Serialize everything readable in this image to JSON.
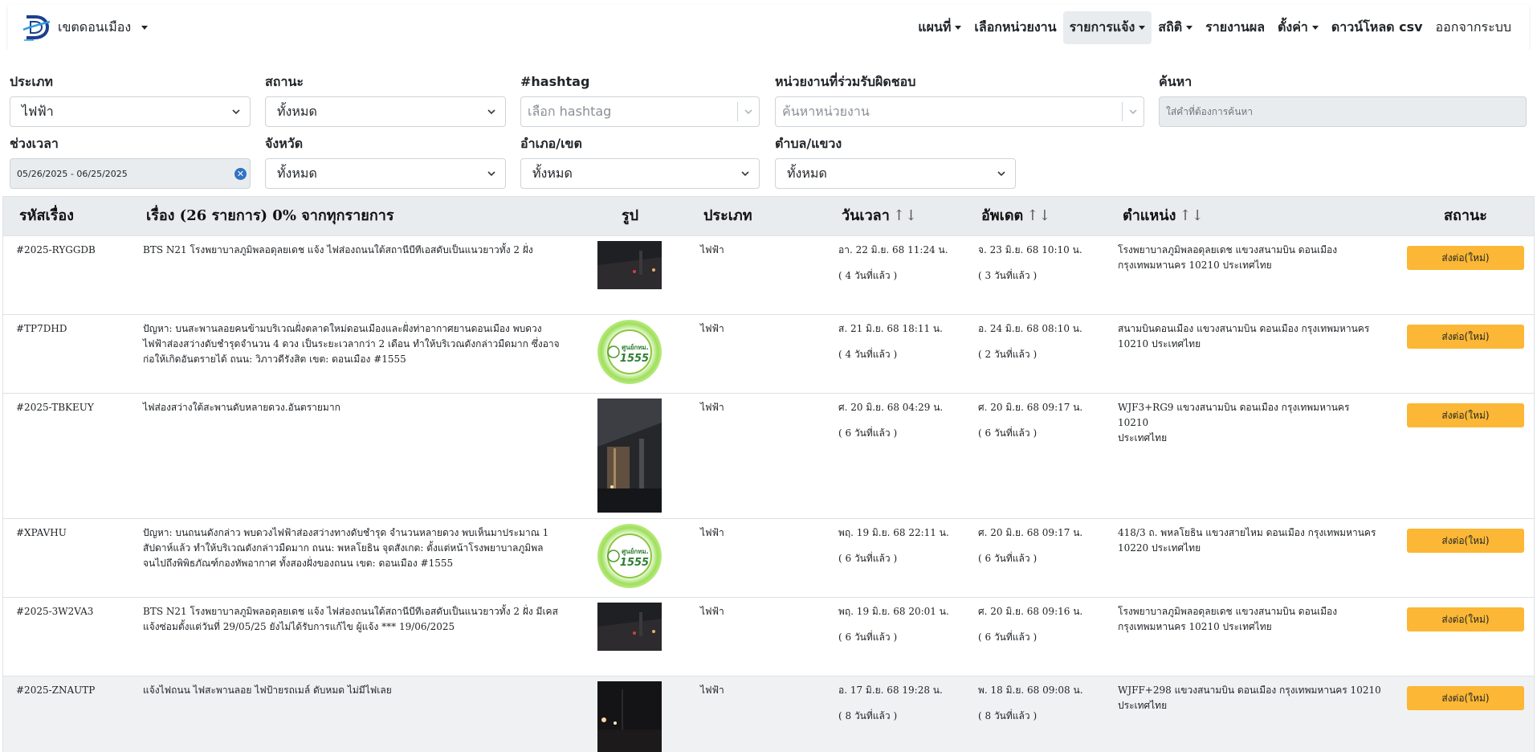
{
  "nav": {
    "district": "เขตดอนเมือง",
    "items": [
      {
        "label": "แผนที่",
        "dropdown": true,
        "active": false,
        "bold": true
      },
      {
        "label": "เลือกหน่วยงาน",
        "dropdown": false,
        "active": false,
        "bold": true
      },
      {
        "label": "รายการแจ้ง",
        "dropdown": true,
        "active": true,
        "bold": true
      },
      {
        "label": "สถิติ",
        "dropdown": true,
        "active": false,
        "bold": true
      },
      {
        "label": "รายงานผล",
        "dropdown": false,
        "active": false,
        "bold": true
      },
      {
        "label": "ตั้งค่า",
        "dropdown": true,
        "active": false,
        "bold": true
      },
      {
        "label": "ดาวน์โหลด csv",
        "dropdown": false,
        "active": false,
        "bold": true
      },
      {
        "label": "ออกจากระบบ",
        "dropdown": false,
        "active": false,
        "bold": false
      }
    ]
  },
  "filters": {
    "type": {
      "label": "ประเภท",
      "value": "ไฟฟ้า"
    },
    "status": {
      "label": "สถานะ",
      "value": "ทั้งหมด"
    },
    "hashtag": {
      "label": "#hashtag",
      "placeholder": "เลือก hashtag"
    },
    "agency": {
      "label": "หน่วยงานที่ร่วมรับผิดชอบ",
      "placeholder": "ค้นหาหน่วยงาน"
    },
    "search": {
      "label": "ค้นหา",
      "placeholder": "ใส่คำที่ต้องการค้นหา"
    },
    "period": {
      "label": "ช่วงเวลา",
      "value": "05/26/2025 - 06/25/2025"
    },
    "province": {
      "label": "จังหวัด",
      "value": "ทั้งหมด"
    },
    "district": {
      "label": "อำเภอ/เขต",
      "value": "ทั้งหมด"
    },
    "subdistrict": {
      "label": "ตำบล/แขวง",
      "value": "ทั้งหมด"
    }
  },
  "table": {
    "headers": {
      "id": "รหัสเรื่อง",
      "title": "เรื่อง (26 รายการ) 0% จากทุกรายการ",
      "image": "รูป",
      "type": "ประเภท",
      "datetime": "วันเวลา",
      "updated": "อัพเดต",
      "location": "ตำแหน่ง",
      "status": "สถานะ"
    },
    "sort_icon": "↑↓",
    "rows": [
      {
        "id": "#2025-RYGGDB",
        "title": [
          "BTS N21 โรงพยาบาลภูมิพลอดุลยเดช แจ้ง ไฟส่องถนนใต้สถานีบีทีเอสดับเป็นแนวยาวทั้ง 2 ฝั่ง"
        ],
        "image": "night-road-photo",
        "type": "ไฟฟ้า",
        "datetime": "อา. 22 มิ.ย. 68 11:24 น.",
        "datetime_ago": "( 4 วันที่แล้ว )",
        "updated": "จ. 23 มิ.ย. 68 10:10 น.",
        "updated_ago": "( 3 วันที่แล้ว )",
        "location": [
          "โรงพยาบาลภูมิพลอดุลยเดช แขวงสนามบิน ดอนเมือง",
          "กรุงเทพมหานคร 10210 ประเทศไทย"
        ],
        "status": "ส่งต่อ(ใหม่)"
      },
      {
        "id": "#TP7DHD",
        "title": [
          "ปัญหา: บนสะพานลอยคนข้ามบริเวณฝั่งตลาดใหม่ดอนเมืองและฝั่งท่าอากาศยานดอนเมือง พบดวง",
          "ไฟฟ้าส่องสว่างดับชำรุดจำนวน 4 ดวง เป็นระยะเวลากว่า 2 เดือน ทำให้บริเวณดังกล่าวมืดมาก ซึ่งอาจ",
          "ก่อให้เกิดอันตรายได้ ถนน: วิภาวดีรังสิต เขต: ดอนเมือง #1555"
        ],
        "image": "1555-logo",
        "type": "ไฟฟ้า",
        "datetime": "ส. 21 มิ.ย. 68 18:11 น.",
        "datetime_ago": "( 4 วันที่แล้ว )",
        "updated": "อ. 24 มิ.ย. 68 08:10 น.",
        "updated_ago": "( 2 วันที่แล้ว )",
        "location": [
          "สนามบินดอนเมือง แขวงสนามบิน ดอนเมือง กรุงเทพมหานคร",
          "10210 ประเทศไทย"
        ],
        "status": "ส่งต่อ(ใหม่)"
      },
      {
        "id": "#2025-TBKEUY",
        "title": [
          "ไฟส่องสว่างใต้สะพานดับหลายดวง.อันตรายมาก"
        ],
        "image": "under-bridge-photo",
        "type": "ไฟฟ้า",
        "datetime": "ศ. 20 มิ.ย. 68 04:29 น.",
        "datetime_ago": "( 6 วันที่แล้ว )",
        "updated": "ศ. 20 มิ.ย. 68 09:17 น.",
        "updated_ago": "( 6 วันที่แล้ว )",
        "location": [
          "WJF3+RG9 แขวงสนามบิน ดอนเมือง กรุงเทพมหานคร 10210",
          "ประเทศไทย"
        ],
        "status": "ส่งต่อ(ใหม่)"
      },
      {
        "id": "#XPAVHU",
        "title": [
          "ปัญหา: บนถนนดังกล่าว พบดวงไฟฟ้าส่องสว่างทางดับชำรุด จำนวนหลายดวง พบเห็นมาประมาณ 1",
          "สัปดาห์แล้ว ทำให้บริเวณดังกล่าวมืดมาก ถนน: พหลโยธิน จุดสังเกต: ตั้งแต่หน้าโรงพยาบาลภูมิพล",
          "จนไปถึงพิพิธภัณฑ์กองทัพอากาศ ทั้งสองฝั่งของถนน เขต: ดอนเมือง #1555"
        ],
        "image": "1555-logo",
        "type": "ไฟฟ้า",
        "datetime": "พฤ. 19 มิ.ย. 68 22:11 น.",
        "datetime_ago": "( 6 วันที่แล้ว )",
        "updated": "ศ. 20 มิ.ย. 68 09:17 น.",
        "updated_ago": "( 6 วันที่แล้ว )",
        "location": [
          "418/3 ถ. พหลโยธิน แขวงสายไหม ดอนเมือง กรุงเทพมหานคร",
          "10220 ประเทศไทย"
        ],
        "status": "ส่งต่อ(ใหม่)"
      },
      {
        "id": "#2025-3W2VA3",
        "title": [
          "BTS N21 โรงพยาบาลภูมิพลอดุลยเดช แจ้ง ไฟส่องถนนใต้สถานีบีทีเอสดับเป็นแนวยาวทั้ง 2 ฝั่ง มีเคส",
          "แจ้งซ่อมตั้งแต่วันที่ 29/05/25 ยังไม่ได้รับการแก้ไข ผู้แจ้ง *** 19/06/2025"
        ],
        "image": "night-road-photo",
        "type": "ไฟฟ้า",
        "datetime": "พฤ. 19 มิ.ย. 68 20:01 น.",
        "datetime_ago": "( 6 วันที่แล้ว )",
        "updated": "ศ. 20 มิ.ย. 68 09:16 น.",
        "updated_ago": "( 6 วันที่แล้ว )",
        "location": [
          "โรงพยาบาลภูมิพลอดุลยเดช แขวงสนามบิน ดอนเมือง",
          "กรุงเทพมหานคร 10210 ประเทศไทย"
        ],
        "status": "ส่งต่อ(ใหม่)"
      },
      {
        "id": "#2025-ZNAUTP",
        "title": [
          "แจ้งไฟถนน ไฟสะพานลอย ไฟป้ายรถเมล์ ดับหมด ไม่มีไฟเลย"
        ],
        "image": "dark-street-photo",
        "type": "ไฟฟ้า",
        "datetime": "อ. 17 มิ.ย. 68 19:28 น.",
        "datetime_ago": "( 8 วันที่แล้ว )",
        "updated": "พ. 18 มิ.ย. 68 09:08 น.",
        "updated_ago": "( 8 วันที่แล้ว )",
        "location": [
          "WJFF+298 แขวงสนามบิน ดอนเมือง กรุงเทพมหานคร 10210",
          "ประเทศไทย"
        ],
        "status": "ส่งต่อ(ใหม่)"
      }
    ]
  },
  "badge_1555": {
    "line1": "ศูนย์กทม.",
    "line2": "1555"
  },
  "colors": {
    "status_button": "#fbb735",
    "active_nav": "#e9ecef",
    "clear_button": "#2f73c4",
    "table_header": "#e9ecef"
  }
}
